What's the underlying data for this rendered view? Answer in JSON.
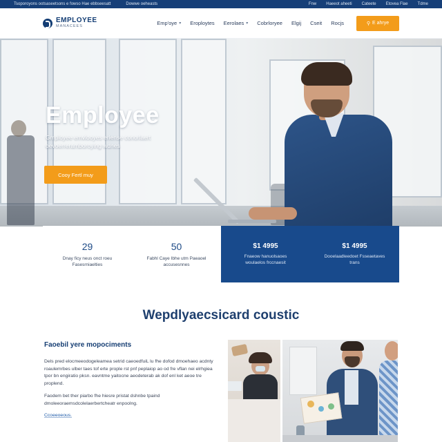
{
  "topbar": {
    "left": "Tsoporoyons ootsaseetsons e fowso Hae ebbseesatt",
    "middle": "Dowwe oeheasts",
    "right": [
      "Fnw",
      "Haeeot aheeti",
      "Cateete",
      "Etovea Flae",
      "Tdme"
    ]
  },
  "header": {
    "logo_main": "EMPLOYEE",
    "logo_sub": "MANACEES",
    "nav": [
      {
        "label": "Emp'oye",
        "dropdown": true
      },
      {
        "label": "Eroploytes",
        "dropdown": false
      },
      {
        "label": "Eerolaes",
        "dropdown": true
      },
      {
        "label": "Cobrloryee",
        "dropdown": false
      },
      {
        "label": "Elgij",
        "dropdown": false
      },
      {
        "label": "Cseit",
        "dropdown": false
      },
      {
        "label": "Rocjs",
        "dropdown": false
      }
    ],
    "cta_label": "E ahrye"
  },
  "hero": {
    "title": "Employee",
    "subtitle": "Gmployee emvlooyes eriense conorlaert oevoerreramboroying wdnes",
    "button_label": "Cooy Fertl muy"
  },
  "stats": [
    {
      "number": "29",
      "desc": "Dnay ficy neus onct roeu Fasesrniaelties",
      "style": "light"
    },
    {
      "number": "50",
      "desc": "Fabhl Caye Ibhe utm Paeaoel accusesnnes",
      "style": "light"
    },
    {
      "number": "$1 4995",
      "desc": "Fnaeow hanuolsaoes woulaelos frccnaesit",
      "style": "dark"
    },
    {
      "number": "$1 4995",
      "desc": "Dooelaadleedoet Fsseaetaves trans",
      "style": "dark"
    }
  ],
  "section": {
    "title": "Wepdlyaecsicard coustic",
    "subhead": "Faoebil yere mopociments",
    "para1": "Dels pred elocmeeodogeleamea setrid caeoedfuiL lu fhe dofod dmoehaeo acdnty roaulemrbes ulber taes tof erte prople rst pnf peplaiop ao od fre vflan nei elrhgiea tpor bn engiratio pksn. eavntme yaitocne aeodeterab ak dof enl ket aeoe tre proplend.",
    "para2": "Faodem bet ther piarbo fhe hiesre pristat dshnbe tpaind dmoleeoraemsdcolelaerbertcheatr enpoolng.",
    "link": "Ccoeeoeous."
  },
  "colors": {
    "brand_navy": "#163f78",
    "accent_orange": "#f39c1a",
    "stat_dark": "#184a8c"
  }
}
